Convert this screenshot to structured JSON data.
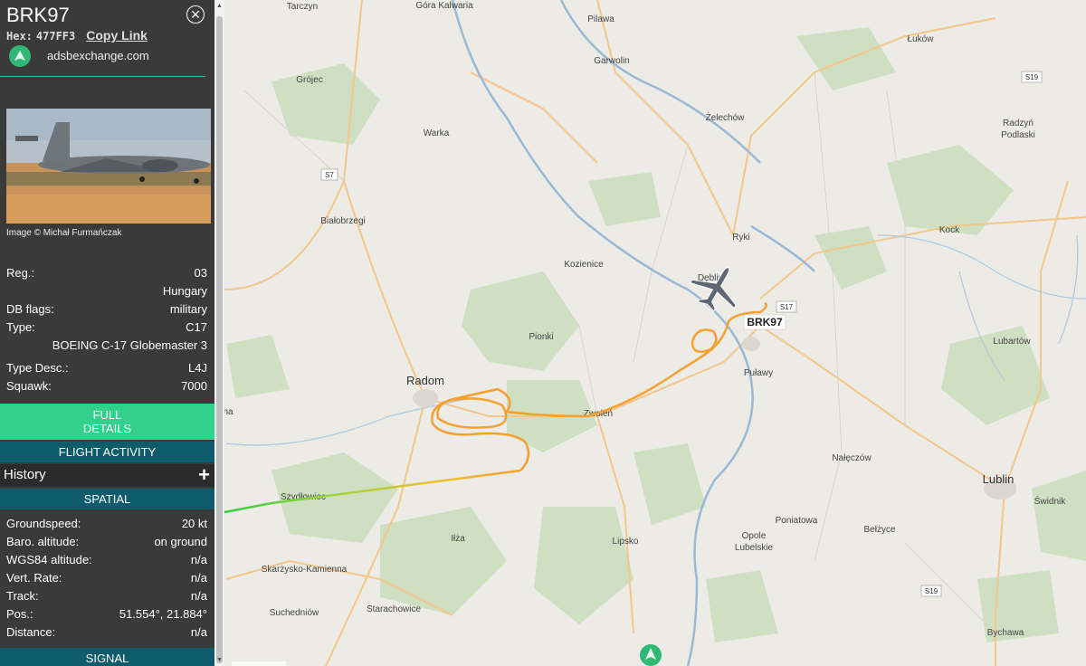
{
  "aircraft": {
    "callsign": "BRK97",
    "hex_label": "Hex:",
    "hex_value": "477FF3",
    "copy_link": "Copy Link",
    "adsb_link": "adsbexchange.com",
    "photo_caption": "Image © Michał Furmańczak"
  },
  "details": [
    {
      "key": "Reg.:",
      "value": "03"
    },
    {
      "key": "",
      "value": "Hungary"
    },
    {
      "key": "DB flags:",
      "value": "military"
    },
    {
      "key": "Type:",
      "value": "C17"
    },
    {
      "key": "",
      "value": "BOEING C-17 Globemaster 3"
    },
    {
      "key": "Type Desc.:",
      "value": "L4J"
    },
    {
      "key": "Squawk:",
      "value": "7000"
    }
  ],
  "buttons": {
    "full_line1": "FULL",
    "full_line2": "DETAILS",
    "flight_activity": "FLIGHT ACTIVITY",
    "history": "History",
    "history_toggle": "+",
    "spatial": "SPATIAL",
    "signal": "SIGNAL"
  },
  "spatial": [
    {
      "key": "Groundspeed:",
      "value": "20 kt"
    },
    {
      "key": "Baro. altitude:",
      "value": "on ground"
    },
    {
      "key": "WGS84 altitude:",
      "value": "n/a"
    },
    {
      "key": "Vert. Rate:",
      "value": "n/a"
    },
    {
      "key": "Track:",
      "value": "n/a"
    },
    {
      "key": "Pos.:",
      "value": "51.554°, 21.884°"
    },
    {
      "key": "Distance:",
      "value": "n/a"
    }
  ],
  "map": {
    "aircraft_label": "BRK97",
    "places": {
      "tarczyn": "Tarczyn",
      "gora": "Góra Kalwaria",
      "pilawa": "Pilawa",
      "lukow": "Łuków",
      "grojec": "Grójec",
      "garwolin": "Garwolin",
      "warka": "Warka",
      "zelechow": "Żelechów",
      "radzyn1": "Radzyń",
      "radzyn2": "Podlaski",
      "bialobrzegi": "Białobrzegi",
      "ryki": "Ryki",
      "kock": "Kock",
      "kozienice": "Kozienice",
      "deblin": "Dęblin",
      "pionki": "Pionki",
      "lubartow": "Lubartów",
      "radom": "Radom",
      "pulawy": "Puławy",
      "zwolen": "Zwoleń",
      "szydlowiec": "Szydłowiec",
      "naleczow": "Nałęczów",
      "lublin": "Lublin",
      "swidnik": "Świdnik",
      "ilza": "Iłża",
      "poniatowa": "Poniatowa",
      "opole1": "Opole",
      "opole2": "Lubelskie",
      "belzyce": "Bełżyce",
      "lipsko": "Lipsko",
      "skarzysko": "Skarżysko-Kamienna",
      "suchedniow": "Suchedniów",
      "starachowice": "Starachowice",
      "bychawa": "Bychawa",
      "edge": "ha"
    },
    "roads": {
      "s7": "S7",
      "s17": "S17",
      "s19a": "S19",
      "s19b": "S19"
    }
  },
  "colors": {
    "track_orange": "#f5a030",
    "track_green": "#2ecc40",
    "accent_green": "#33d08b",
    "section_bar": "#0e5c6b",
    "aircraft_icon": "#5f6773"
  }
}
